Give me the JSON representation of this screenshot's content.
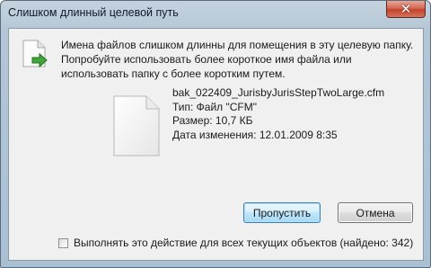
{
  "window": {
    "title": "Слишком длинный целевой путь",
    "close_label": "✕"
  },
  "message": {
    "text": "Имена файлов слишком длинны для помещения в эту целевую папку. Попробуйте использовать более короткое имя файла или использовать папку с более коротким путем."
  },
  "file": {
    "name": "bak_022409_JurisbyJurisStepTwoLarge.cfm",
    "type": "Тип: Файл \"CFM\"",
    "size": "Размер: 10,7 КБ",
    "modified": "Дата изменения: 12.01.2009 8:35"
  },
  "buttons": {
    "skip_label": "Пропустить",
    "cancel_label": "Отмена"
  },
  "checkbox": {
    "label": "Выполнять это действие для всех текущих объектов (найдено: 342)",
    "checked": false
  },
  "icons": {
    "warning": "file-copy-arrow-icon",
    "file": "blank-file-icon",
    "close": "close-icon"
  },
  "colors": {
    "frame": "#aac1d3",
    "close_button": "#c2432d",
    "content_bg": "#f0f0f0",
    "default_button_border": "#3c7fb1"
  }
}
